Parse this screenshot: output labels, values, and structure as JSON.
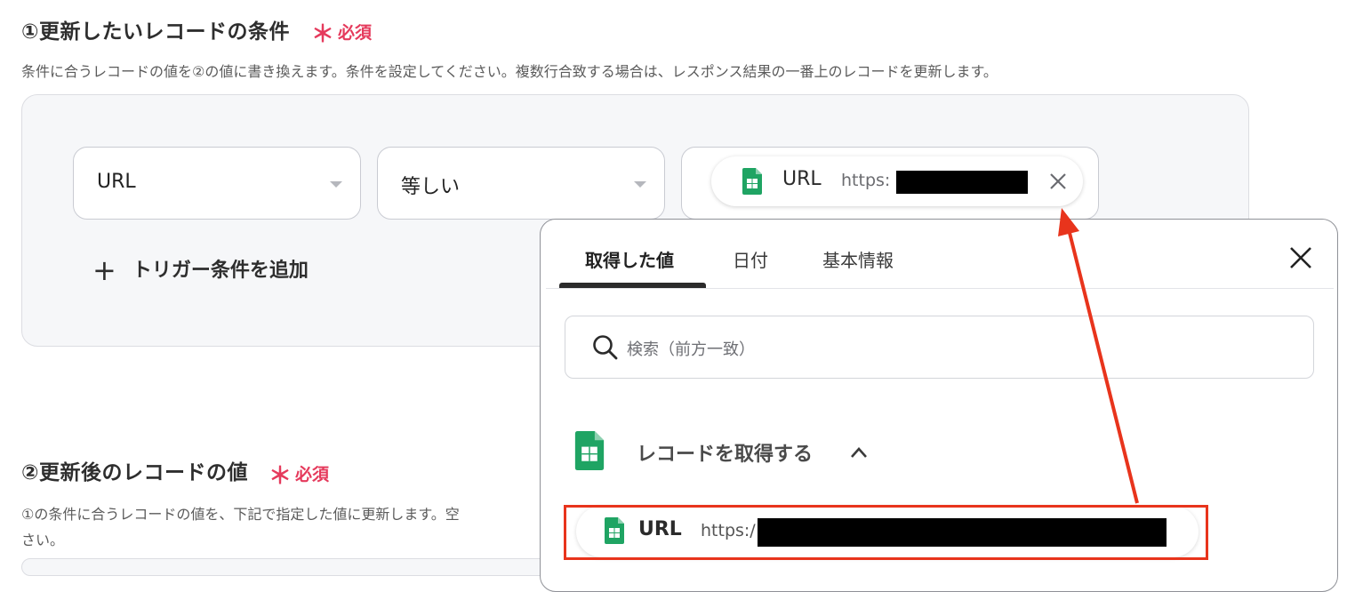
{
  "section1": {
    "title": "①更新したいレコードの条件",
    "required_mark": "＊",
    "required_label": "必須",
    "description": "条件に合うレコードの値を②の値に書き換えます。条件を設定してください。複数行合致する場合は、レスポンス結果の一番上のレコードを更新します。"
  },
  "condition": {
    "field_value": "URL",
    "operator_value": "等しい",
    "chip": {
      "label": "URL",
      "value": "https:",
      "value_redacted": true
    },
    "add_trigger_icon": "plus-icon",
    "add_trigger_label": "トリガー条件を追加"
  },
  "section2": {
    "title": "②更新後のレコードの値",
    "required_mark": "＊",
    "required_label": "必須",
    "description_line1": "①の条件に合うレコードの値を、下記で指定した値に更新します。空",
    "description_line2": "さい。"
  },
  "popup": {
    "tabs": [
      {
        "label": "取得した値",
        "active": true
      },
      {
        "label": "日付",
        "active": false
      },
      {
        "label": "基本情報",
        "active": false
      }
    ],
    "search_placeholder": "検索（前方一致）",
    "group_label": "レコードを取得する",
    "group_expanded": true,
    "item": {
      "label": "URL",
      "value": "https:/",
      "value_redacted": true
    }
  },
  "icons": {
    "sheet": "google-sheets-icon",
    "close": "close-icon",
    "search": "search-icon",
    "chevron": "chevron-up-icon",
    "caret": "caret-down-icon"
  },
  "colors": {
    "required": "#e53a5c",
    "annotation": "#e8341c",
    "sheets_green": "#1fa463"
  }
}
